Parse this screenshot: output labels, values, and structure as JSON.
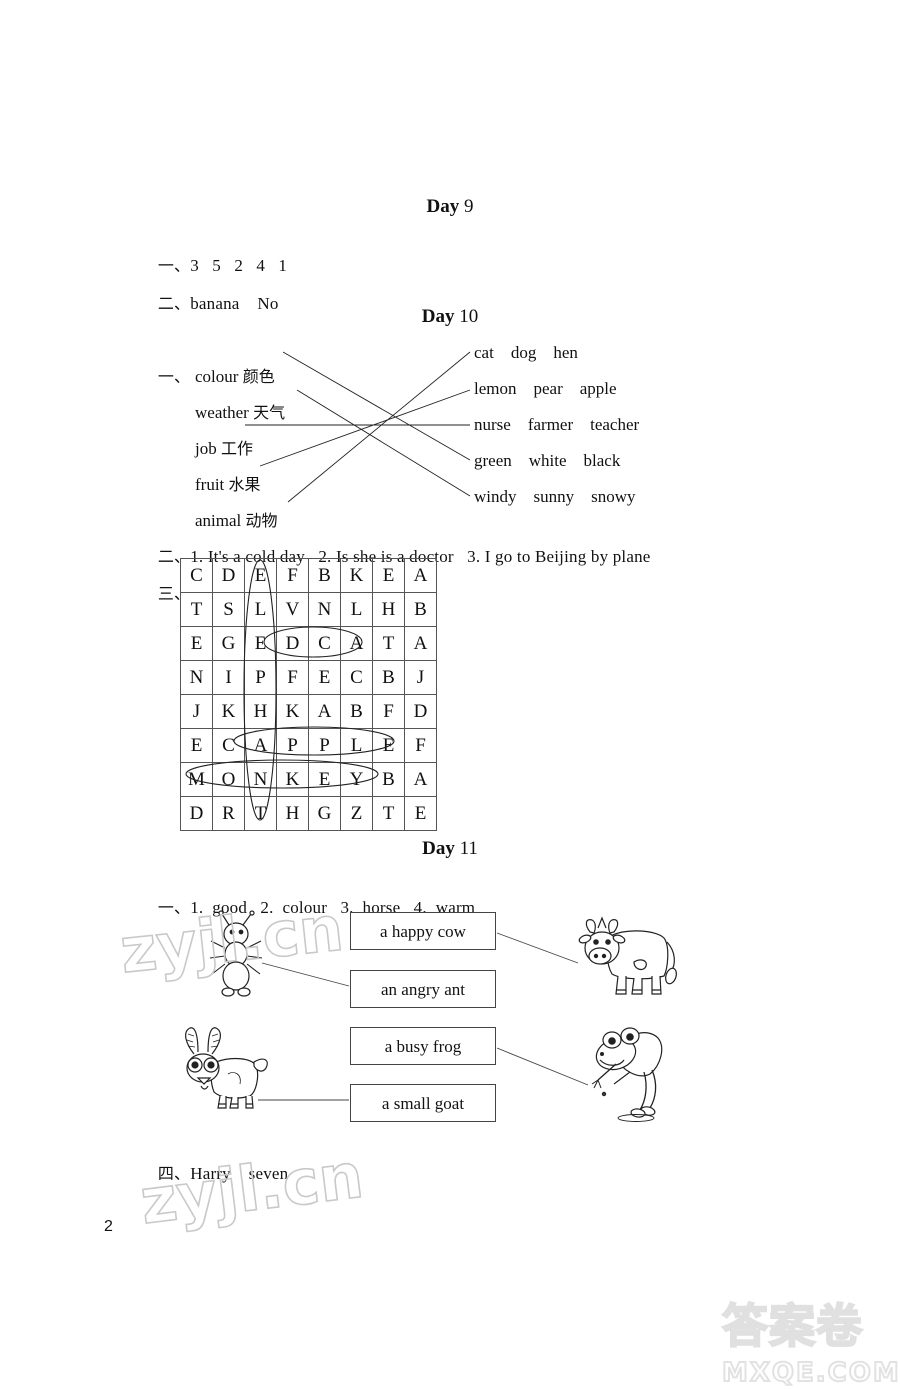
{
  "page": {
    "number": "2",
    "watermark_top": "zyjl.cn",
    "watermark_mid": "zyjl.cn",
    "watermark_brand_cn": "答案卷",
    "watermark_brand_url": "MXQE.COM"
  },
  "day9": {
    "heading_label": "Day",
    "heading_number": "9",
    "items": [
      {
        "marker": "一、",
        "text": "3   5   2   4   1"
      },
      {
        "marker": "二、",
        "text": "banana    No"
      }
    ]
  },
  "day10": {
    "heading_label": "Day",
    "heading_number": "10",
    "exercise1_marker": "一、",
    "match_left": [
      {
        "en": "colour",
        "zh": "颜色"
      },
      {
        "en": "weather",
        "zh": "天气"
      },
      {
        "en": "job",
        "zh": "工作"
      },
      {
        "en": "fruit",
        "zh": "水果"
      },
      {
        "en": "animal",
        "zh": "动物"
      }
    ],
    "match_right": [
      {
        "words": "cat    dog    hen"
      },
      {
        "words": "lemon    pear    apple"
      },
      {
        "words": "nurse    farmer    teacher"
      },
      {
        "words": "green    white    black"
      },
      {
        "words": "windy    sunny    snowy"
      }
    ],
    "match_pairs": [
      {
        "left": "colour",
        "right": "green"
      },
      {
        "left": "weather",
        "right": "windy"
      },
      {
        "left": "job",
        "right": "nurse"
      },
      {
        "left": "fruit",
        "right": "lemon"
      },
      {
        "left": "animal",
        "right": "cat"
      }
    ],
    "exercise2_marker": "二、",
    "exercise2_text": "1. It's a cold day   2. Is she is a doctor   3. I go to Beijing by plane",
    "exercise3_marker": "三、",
    "grid": {
      "rows": [
        [
          "C",
          "D",
          "E",
          "F",
          "B",
          "K",
          "E",
          "A"
        ],
        [
          "T",
          "S",
          "L",
          "V",
          "N",
          "L",
          "H",
          "B"
        ],
        [
          "E",
          "G",
          "E",
          "D",
          "C",
          "A",
          "T",
          "A"
        ],
        [
          "N",
          "I",
          "P",
          "F",
          "E",
          "C",
          "B",
          "J"
        ],
        [
          "J",
          "K",
          "H",
          "K",
          "A",
          "B",
          "F",
          "D"
        ],
        [
          "E",
          "C",
          "A",
          "P",
          "P",
          "L",
          "E",
          "F"
        ],
        [
          "M",
          "O",
          "N",
          "K",
          "E",
          "Y",
          "B",
          "A"
        ],
        [
          "D",
          "R",
          "T",
          "H",
          "G",
          "Z",
          "T",
          "E"
        ]
      ],
      "circled_words": [
        {
          "word": "CAT",
          "orientation": "horizontal",
          "row": 2,
          "col_start": 4,
          "col_end": 6
        },
        {
          "word": "APPLE",
          "orientation": "horizontal",
          "row": 5,
          "col_start": 2,
          "col_end": 6
        },
        {
          "word": "MONKEY",
          "orientation": "horizontal",
          "row": 6,
          "col_start": 0,
          "col_end": 5
        },
        {
          "word": "ELEPHANT",
          "orientation": "vertical",
          "col": 2,
          "row_start": 0,
          "row_end": 7
        }
      ]
    }
  },
  "day11": {
    "heading_label": "Day",
    "heading_number": "11",
    "exercise1_marker": "一、",
    "exercise1_text": "1.  good   2.  colour   3.  horse   4.  warm",
    "phrase_boxes": [
      {
        "text": "a happy cow",
        "connects_to": "cow"
      },
      {
        "text": "an angry ant",
        "connects_to": "ant"
      },
      {
        "text": "a busy frog",
        "connects_to": "frog"
      },
      {
        "text": "a small goat",
        "connects_to": "goat"
      }
    ],
    "pictures": [
      {
        "name": "ant",
        "side": "left"
      },
      {
        "name": "cow",
        "side": "right"
      },
      {
        "name": "goat",
        "side": "left"
      },
      {
        "name": "frog",
        "side": "right"
      }
    ],
    "exercise4_marker": "四、",
    "exercise4_text": "Harry    seven"
  }
}
